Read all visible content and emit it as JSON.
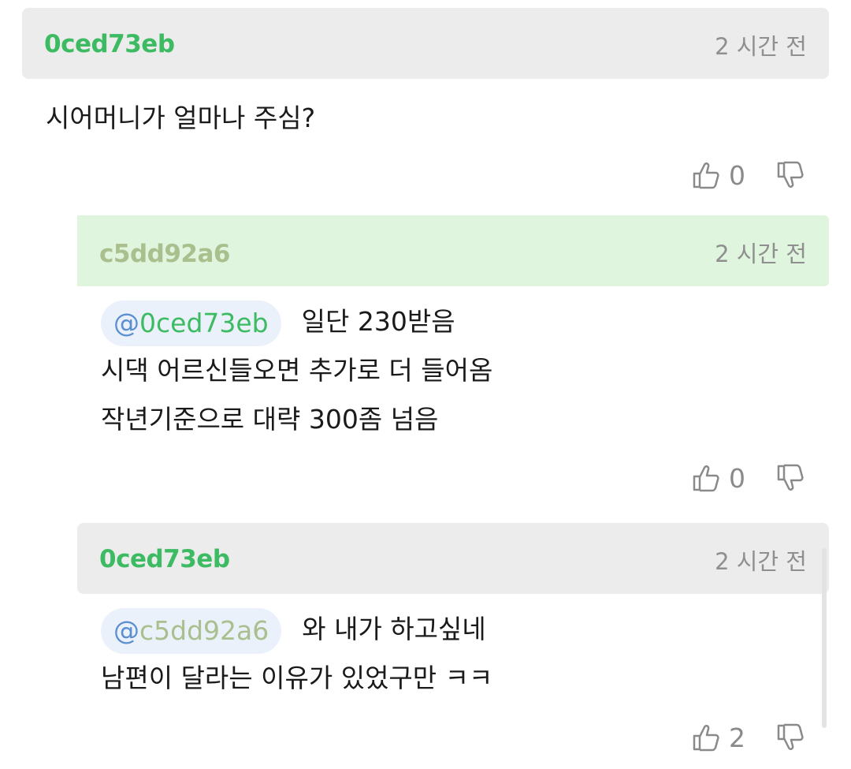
{
  "comments": [
    {
      "author": "0ced73eb",
      "time": "2 시간 전",
      "lines": [
        "시어머니가 얼마나 주심?"
      ],
      "likes": "0"
    },
    {
      "author": "c5dd92a6",
      "time": "2 시간 전",
      "mention_at": "@",
      "mention_user": "0ced73eb",
      "lines": [
        "일단 230받음",
        "시댁 어르신들오면 추가로 더 들어옴",
        "작년기준으로 대략 300좀 넘음"
      ],
      "likes": "0"
    },
    {
      "author": "0ced73eb",
      "time": "2 시간 전",
      "mention_at": "@",
      "mention_user": "c5dd92a6",
      "lines": [
        "와 내가 하고싶네",
        "남편이 달라는 이유가 있었구만 ㅋㅋ"
      ],
      "likes": "2"
    }
  ],
  "icons": {
    "like": "thumbs-up-icon",
    "dislike": "thumbs-down-icon"
  },
  "colors": {
    "author_green": "#3dbb63",
    "author_olive": "#a9bf8d",
    "mention_at": "#5b8fd0",
    "header_gray": "#ececec",
    "header_green": "#dff5de",
    "mention_bg": "#eaf1fa"
  }
}
